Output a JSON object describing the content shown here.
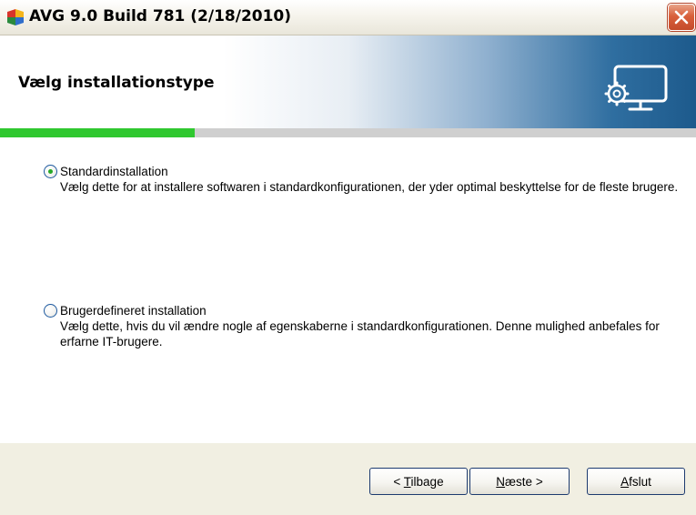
{
  "window": {
    "title": "AVG 9.0 Build 781 (2/18/2010)"
  },
  "header": {
    "title": "Vælg installationstype",
    "icon": "monitor-gear-icon"
  },
  "progress": {
    "fraction": 0.28,
    "color": "#2fc82f"
  },
  "options": [
    {
      "label": "Standardinstallation",
      "description": "Vælg dette for at installere softwaren i standardkonfigurationen, der yder optimal beskyttelse for de fleste brugere.",
      "selected": true
    },
    {
      "label": "Brugerdefineret installation",
      "description": "Vælg dette, hvis du vil ændre nogle af egenskaberne i standardkonfigurationen. Denne mulighed anbefales for erfarne IT-brugere.",
      "selected": false
    }
  ],
  "buttons": {
    "back": {
      "prefix": "< ",
      "mnemonic": "T",
      "rest": "ilbage",
      "suffix": ""
    },
    "next": {
      "prefix": "",
      "mnemonic": "N",
      "rest": "æste",
      "suffix": " >"
    },
    "cancel": {
      "prefix": "",
      "mnemonic": "A",
      "rest": "fslut",
      "suffix": ""
    }
  },
  "colors": {
    "accent": "#1d5a8c",
    "footer": "#f1efe2",
    "close": "#d9603b"
  }
}
